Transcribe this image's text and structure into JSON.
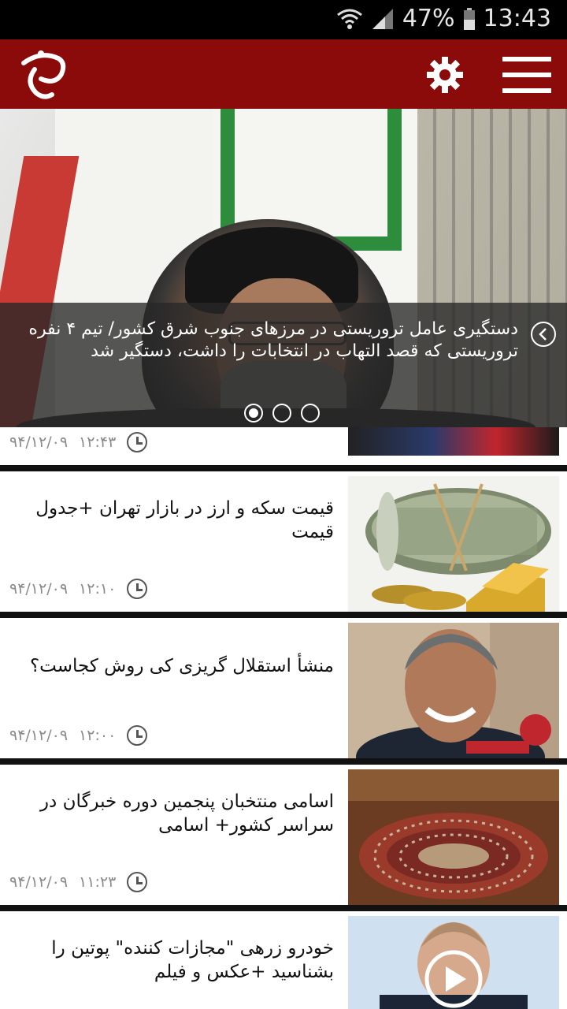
{
  "status_bar": {
    "battery": "47%",
    "time": "13:43"
  },
  "app": {
    "logo_icon": "app-logo-icon",
    "settings_icon": "gear-icon",
    "menu_icon": "hamburger-icon",
    "brand_color": "#8b0a0a"
  },
  "slider": {
    "caption": "دستگیری عامل تروریستی در مرزهای جنوب شرق کشور/ تیم ۴ نفره تروریستی که قصد التهاب در انتخابات را داشت، دستگیر شد",
    "total_slides": 3,
    "active_slide": 1
  },
  "news": [
    {
      "title": "",
      "time": "۱۲:۴۳",
      "date": "۹۴/۱۲/۰۹"
    },
    {
      "title": "قیمت سکه و ارز در بازار تهران +جدول قیمت",
      "time": "۱۲:۱۰",
      "date": "۹۴/۱۲/۰۹"
    },
    {
      "title": "منشأ استقلال گریزی کی روش کجاست؟",
      "time": "۱۲:۰۰",
      "date": "۹۴/۱۲/۰۹"
    },
    {
      "title": "اسامی منتخبان پنجمین دوره خبرگان در سراسر کشور+ اسامی",
      "time": "۱۱:۲۳",
      "date": "۹۴/۱۲/۰۹"
    },
    {
      "title": "خودرو زرهی \"مجازات کننده\" پوتین را بشناسید +عکس و فیلم",
      "time": "",
      "date": ""
    }
  ]
}
